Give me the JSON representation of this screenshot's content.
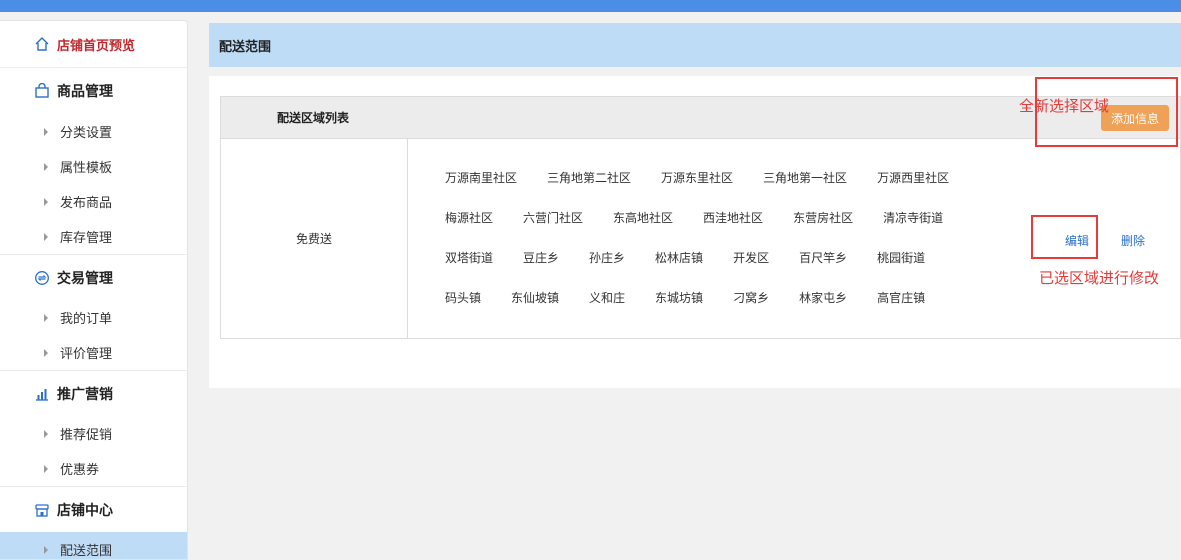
{
  "sidebar": {
    "home": "店铺首页预览",
    "sections": [
      {
        "title": "商品管理",
        "icon": "bag-icon",
        "items": [
          "分类设置",
          "属性模板",
          "发布商品",
          "库存管理"
        ]
      },
      {
        "title": "交易管理",
        "icon": "exchange-icon",
        "items": [
          "我的订单",
          "评价管理"
        ]
      },
      {
        "title": "推广营销",
        "icon": "bar-chart-icon",
        "items": [
          "推荐促销",
          "优惠券"
        ]
      },
      {
        "title": "店铺中心",
        "icon": "store-icon",
        "items": [
          "配送范围"
        ]
      }
    ]
  },
  "header": {
    "title": "配送范围"
  },
  "list": {
    "title": "配送区域列表",
    "add_button": "添加信息",
    "row": {
      "name": "免费送",
      "areas": [
        [
          "万源南里社区",
          "三角地第二社区",
          "万源东里社区",
          "三角地第一社区",
          "万源西里社区"
        ],
        [
          "梅源社区",
          "六营门社区",
          "东高地社区",
          "西洼地社区",
          "东营房社区",
          "清凉寺街道"
        ],
        [
          "双塔街道",
          "豆庄乡",
          "孙庄乡",
          "松林店镇",
          "开发区",
          "百尺竿乡",
          "桃园街道"
        ],
        [
          "码头镇",
          "东仙坡镇",
          "义和庄",
          "东城坊镇",
          "刁窝乡",
          "林家屯乡",
          "高官庄镇"
        ]
      ],
      "edit": "编辑",
      "delete": "删除"
    }
  },
  "annotations": {
    "add_note": "全新选择区域",
    "edit_note": "已选区域进行修改",
    "color": "#e43b3b"
  },
  "colors": {
    "accent": "#4a8ee6",
    "header_bg": "#bfdcf7",
    "button": "#eea157",
    "link": "#2b6fc9",
    "home_red": "#c0282d"
  }
}
